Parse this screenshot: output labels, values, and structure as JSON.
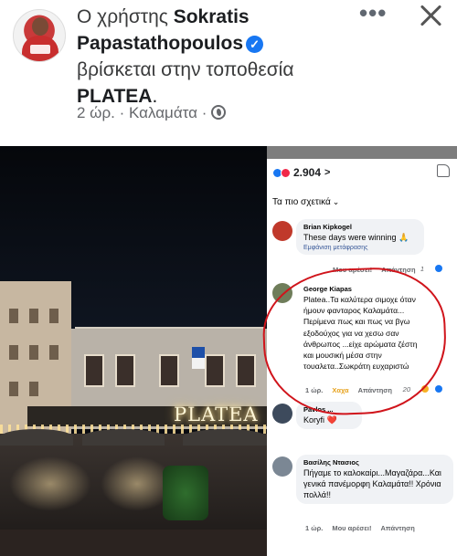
{
  "post": {
    "prefix": "Ο χρήστης",
    "author": "Sokratis Papastathopoulos",
    "verified_glyph": "✓",
    "action": "βρίσκεται στην τοποθεσία",
    "place": "PLATEA",
    "place_suffix": ".",
    "time": "2 ώρ.",
    "location": "Καλαμάτα",
    "separator": "·",
    "more_glyph": "•••"
  },
  "photo": {
    "sign_text": "PLATEA"
  },
  "screenshot": {
    "reaction_count": "2.904",
    "reaction_chevron": ">",
    "sort_label": "Τα πιο σχετικά",
    "sort_chevron": "⌄",
    "comments": [
      {
        "name": "Brian Kipkogel",
        "text": "These days were winning 🙏",
        "sub": "Εμφάνιση μετάφρασης",
        "time": "",
        "like": "Μου αρέσει!",
        "reply": "Απάντηση",
        "reactions": "1",
        "avatar_color": "#c0392b"
      },
      {
        "name": "George Kiapas",
        "text": "Platea..Τα καλύτερα σιμοχε όταν ήμουν φανταρος Καλαμάτα... Περίμενα πως και πως να βγω εξοδούχος για να χεσω σαν άνθρωπος    ...είχε αρώματα ζέστη και μουσική μέσα στην τουαλετα..Σωκράτη ευχαριστώ",
        "sub": "",
        "time": "1 ώρ.",
        "like": "Χαχα",
        "reply": "Απάντηση",
        "reactions": "20",
        "avatar_color": "#6f7d5a"
      },
      {
        "name": "Pavlos ...",
        "text": "Koryfi ❤️",
        "sub": "",
        "time": "",
        "like": "",
        "reply": "",
        "reactions": "",
        "avatar_color": "#3d4a5c"
      },
      {
        "name": "Βασίλης Ντασιος",
        "text": "Πήγαμε το καλοκαίρι...Μαγαζάρα...Και γενικά πανέμορφη Καλαμάτα!! Χρόνια πολλά!!",
        "sub": "",
        "time": "1 ώρ.",
        "like": "Μου αρέσει!",
        "reply": "Απάντηση",
        "reactions": "",
        "avatar_color": "#7b8794"
      }
    ]
  },
  "colors": {
    "accent": "#1877f2",
    "annotation": "#d0141b",
    "muted": "#65676b"
  },
  "icons": {
    "verified": "verified-badge-icon",
    "close": "close-icon",
    "more": "more-options-icon",
    "globe": "globe-icon",
    "like": "thumbs-up-icon"
  }
}
